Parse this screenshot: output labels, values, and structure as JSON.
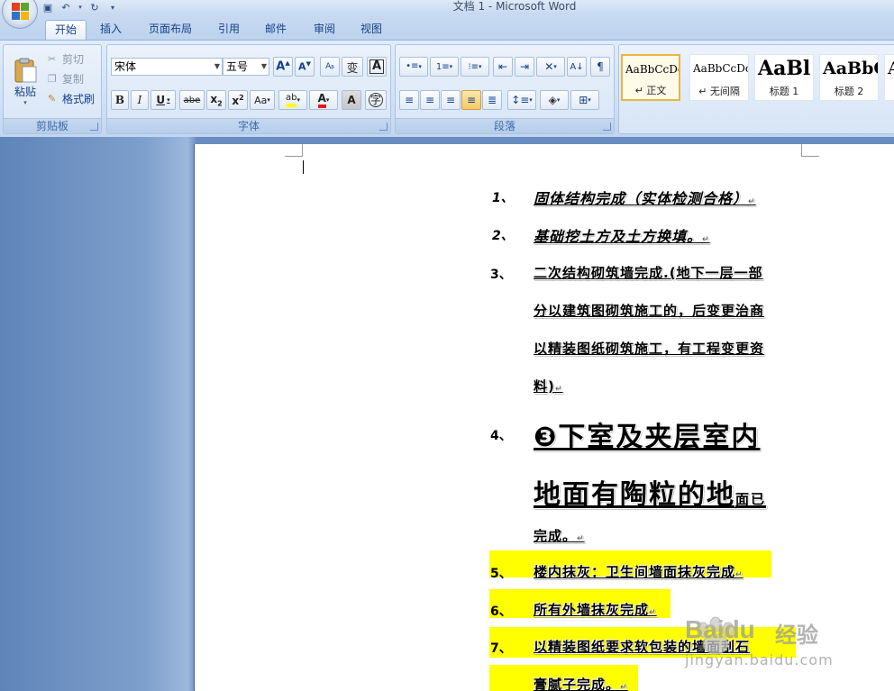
{
  "window": {
    "title": "文档 1 - Microsoft Word"
  },
  "tabs": [
    "开始",
    "插入",
    "页面布局",
    "引用",
    "邮件",
    "审阅",
    "视图"
  ],
  "active_tab": "开始",
  "clipboard": {
    "paste": "粘贴",
    "cut": "剪切",
    "copy": "复制",
    "format_painter": "格式刷",
    "group_label": "剪贴板"
  },
  "font": {
    "name": "宋体",
    "size": "五号",
    "group_label": "字体"
  },
  "paragraph": {
    "group_label": "段落"
  },
  "styles": [
    {
      "sample": "AaBbCcDc",
      "name": "↵ 正文"
    },
    {
      "sample": "AaBbCcDc",
      "name": "↵ 无间隔"
    },
    {
      "sample": "AaBl",
      "name": "标题 1"
    },
    {
      "sample": "AaBbC",
      "name": "标题 2"
    },
    {
      "sample": "A",
      "name": ""
    }
  ],
  "document": {
    "items": [
      {
        "num": "1、",
        "lines": [
          "固体结构完成（实体检测合格）"
        ]
      },
      {
        "num": "2、",
        "lines": [
          "基础挖土方及土方换填。"
        ]
      },
      {
        "num": "3、",
        "lines": [
          "二次结构砌筑墙完成.(地下一层一部",
          "分以建筑图砌筑施工的，后变更治商",
          "以精装图纸砌筑施工，有工程变更资",
          "料)"
        ]
      },
      {
        "num": "4、",
        "lines": [
          "❸下室及夹层室内",
          "地面有陶粒的地",
          "完成。"
        ],
        "tail": "面已"
      },
      {
        "num": "5、",
        "lines": [
          "楼内抹灰：卫生间墙面抹灰完成"
        ]
      },
      {
        "num": "6、",
        "lines": [
          "所有外墙抹灰完成"
        ]
      },
      {
        "num": "7、",
        "lines": [
          "以精装图纸要求软包装的墙面刮石",
          "膏腻子完成。"
        ]
      }
    ],
    "paragraph_mark": "↵"
  },
  "watermark": {
    "brand": "Baidu",
    "label": "经验",
    "url": "jingyan.baidu.com"
  }
}
